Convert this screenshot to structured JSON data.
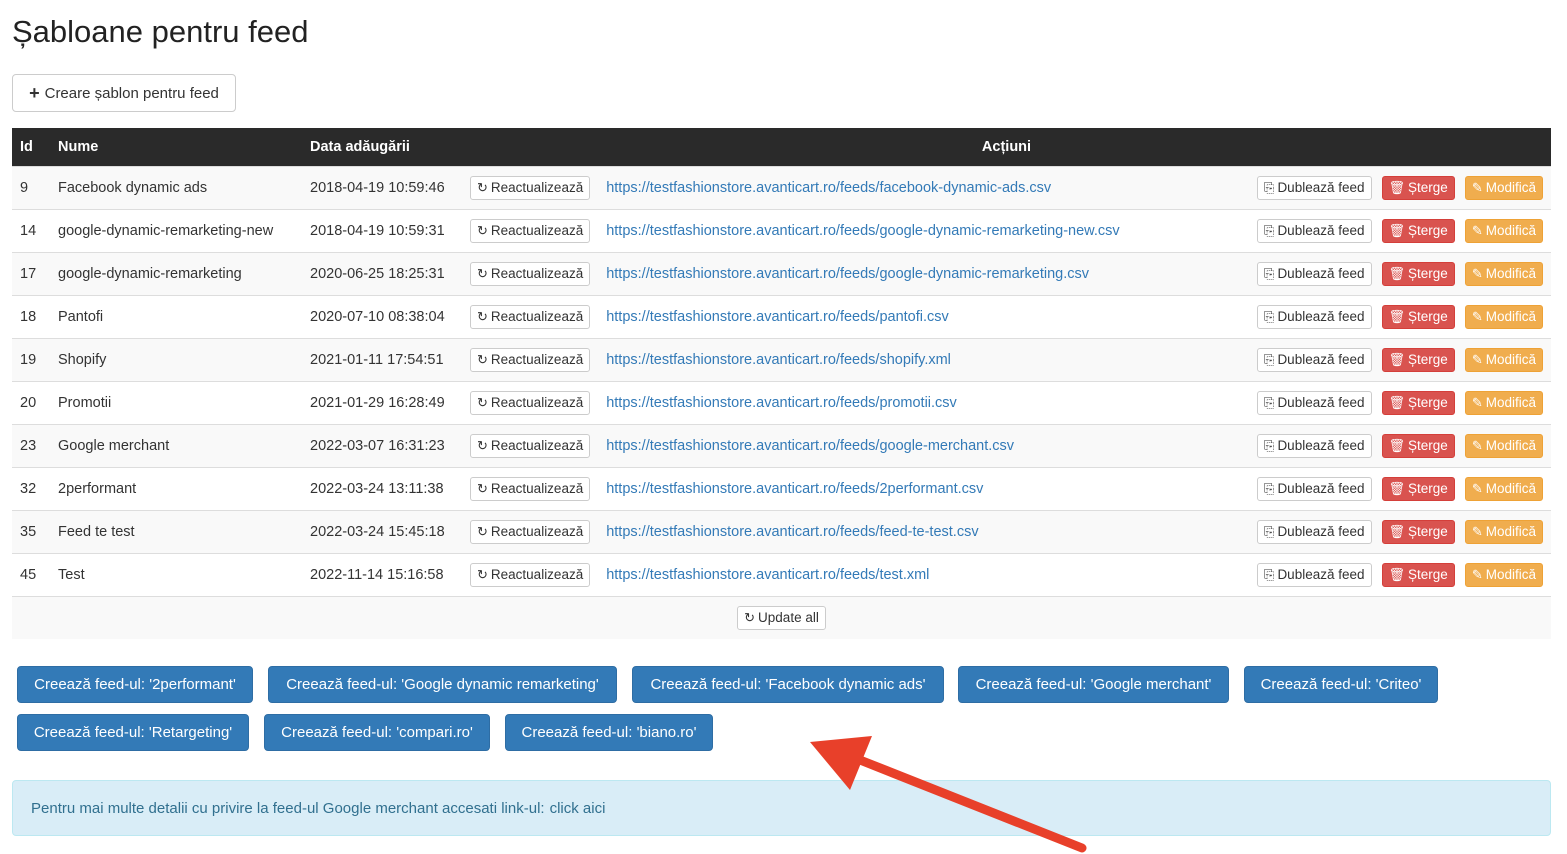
{
  "page": {
    "title": "Șabloane pentru feed"
  },
  "toolbar": {
    "create_label": "Creare șablon pentru feed"
  },
  "table": {
    "headers": {
      "id": "Id",
      "name": "Nume",
      "date": "Data adăugării",
      "actions": "Acțiuni"
    },
    "action_labels": {
      "refresh": "Reactualizează",
      "duplicate": "Dublează feed",
      "delete": "Șterge",
      "edit": "Modifică"
    },
    "rows": [
      {
        "id": "9",
        "name": "Facebook dynamic ads",
        "date": "2018-04-19 10:59:46",
        "url": "https://testfashionstore.avanticart.ro/feeds/facebook-dynamic-ads.csv"
      },
      {
        "id": "14",
        "name": "google-dynamic-remarketing-new",
        "date": "2018-04-19 10:59:31",
        "url": "https://testfashionstore.avanticart.ro/feeds/google-dynamic-remarketing-new.csv"
      },
      {
        "id": "17",
        "name": "google-dynamic-remarketing",
        "date": "2020-06-25 18:25:31",
        "url": "https://testfashionstore.avanticart.ro/feeds/google-dynamic-remarketing.csv"
      },
      {
        "id": "18",
        "name": "Pantofi",
        "date": "2020-07-10 08:38:04",
        "url": "https://testfashionstore.avanticart.ro/feeds/pantofi.csv"
      },
      {
        "id": "19",
        "name": "Shopify",
        "date": "2021-01-11 17:54:51",
        "url": "https://testfashionstore.avanticart.ro/feeds/shopify.xml"
      },
      {
        "id": "20",
        "name": "Promotii",
        "date": "2021-01-29 16:28:49",
        "url": "https://testfashionstore.avanticart.ro/feeds/promotii.csv"
      },
      {
        "id": "23",
        "name": "Google merchant",
        "date": "2022-03-07 16:31:23",
        "url": "https://testfashionstore.avanticart.ro/feeds/google-merchant.csv"
      },
      {
        "id": "32",
        "name": "2performant",
        "date": "2022-03-24 13:11:38",
        "url": "https://testfashionstore.avanticart.ro/feeds/2performant.csv"
      },
      {
        "id": "35",
        "name": "Feed te test",
        "date": "2022-03-24 15:45:18",
        "url": "https://testfashionstore.avanticart.ro/feeds/feed-te-test.csv"
      },
      {
        "id": "45",
        "name": "Test",
        "date": "2022-11-14 15:16:58",
        "url": "https://testfashionstore.avanticart.ro/feeds/test.xml"
      }
    ],
    "update_all_label": "Update all"
  },
  "create_feed_buttons": [
    "Creează feed-ul: '2performant'",
    "Creează feed-ul: 'Google dynamic remarketing'",
    "Creează feed-ul: 'Facebook dynamic ads'",
    "Creează feed-ul: 'Google merchant'",
    "Creează feed-ul: 'Criteo'",
    "Creează feed-ul: 'Retargeting'",
    "Creează feed-ul: 'compari.ro'",
    "Creează feed-ul: 'biano.ro'"
  ],
  "info": {
    "text": "Pentru mai multe detalii cu privire la feed-ul Google merchant accesati link-ul:",
    "link_label": "click aici"
  },
  "icons": {
    "plus": "plus-icon",
    "refresh": "refresh-icon",
    "duplicate": "copy-icon",
    "delete": "trash-icon",
    "edit": "edit-icon"
  },
  "colors": {
    "header_bg": "#2a2a2a",
    "primary": "#337ab7",
    "danger": "#d9534f",
    "warning": "#f0ad4e",
    "info_bg": "#d9edf7",
    "arrow": "#e8402a"
  }
}
